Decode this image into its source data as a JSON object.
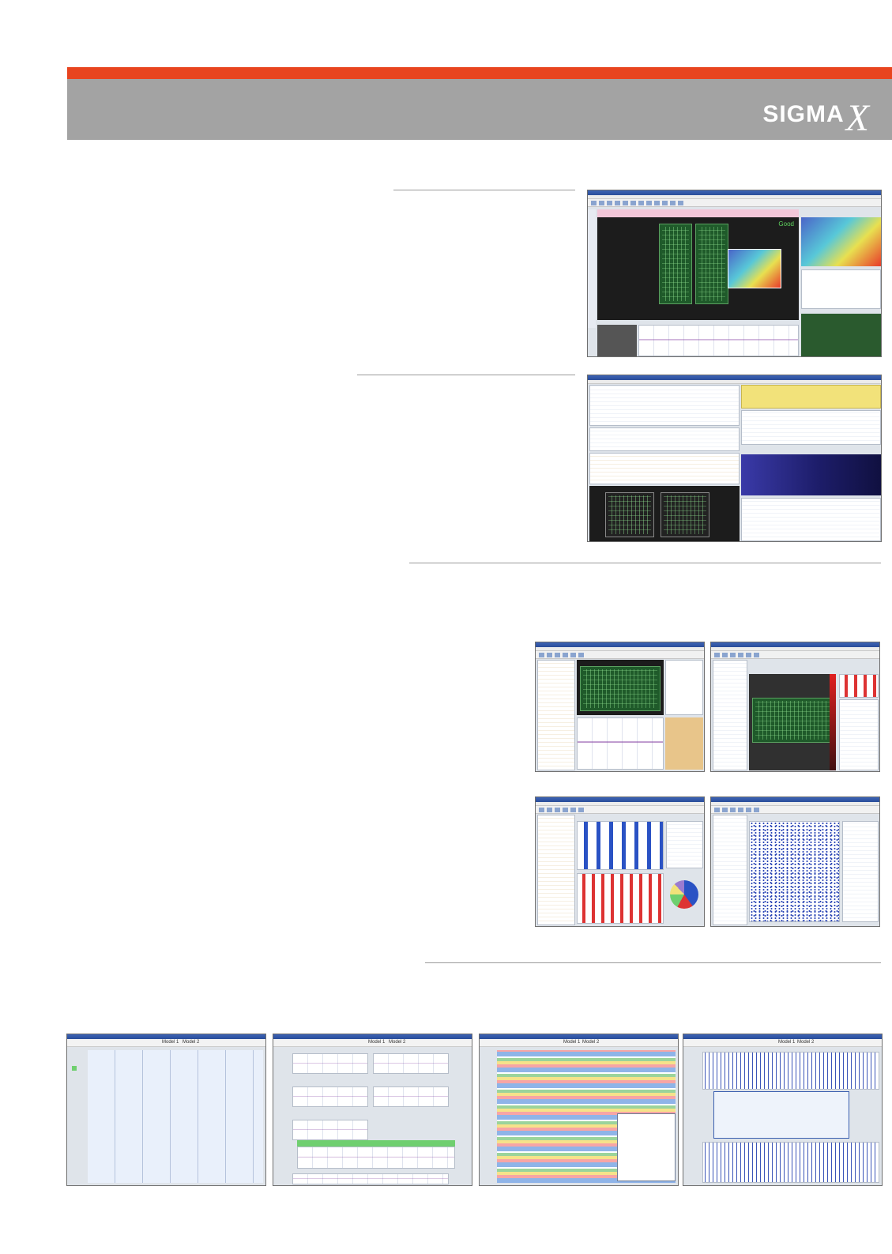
{
  "brand": {
    "logo_text": "SIGMA",
    "logo_x": "X",
    "colors": {
      "accent": "#e8441f",
      "band": "#a3a3a3"
    }
  },
  "screenshots": [
    {
      "name": "3d-inspection-viewer",
      "status_text": "Good"
    },
    {
      "name": "defect-analyzer"
    },
    {
      "name": "monitor-a"
    },
    {
      "name": "monitor-b"
    },
    {
      "name": "monitor-c"
    },
    {
      "name": "monitor-d"
    },
    {
      "name": "line-view-1",
      "model_tabs": [
        "Model 1",
        "Model 2"
      ]
    },
    {
      "name": "line-view-2",
      "model_tabs": [
        "Model 1",
        "Model 2"
      ]
    },
    {
      "name": "line-view-3",
      "model_tabs": [
        "Model 1",
        "Model 2"
      ]
    },
    {
      "name": "line-view-4",
      "model_tabs": [
        "Model 1",
        "Model 2"
      ]
    }
  ]
}
